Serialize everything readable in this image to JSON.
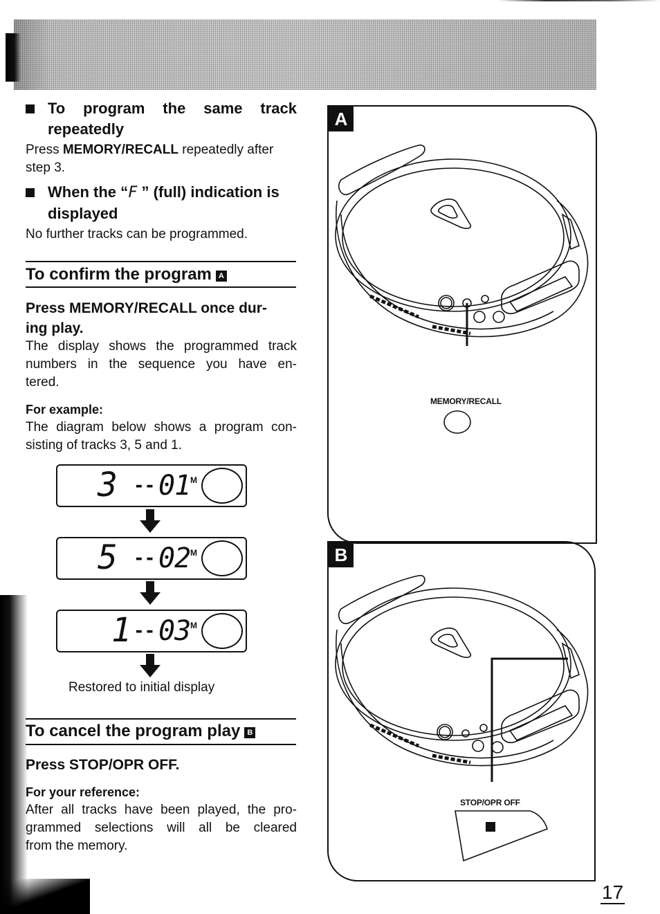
{
  "page": {
    "number": "17"
  },
  "left_column": {
    "repeat_section": {
      "heading": "To program the same track repeatedly",
      "heading_line1": "To program the same track",
      "heading_line2": "repeatedly",
      "body_prefix": "Press ",
      "body_bold": "MEMORY/RECALL",
      "body_suffix": " repeatedly after",
      "body_line2": "step 3."
    },
    "full_section": {
      "heading_line1_prefix": "When the “",
      "full_symbol": "F",
      "heading_line1_suffix": " ” (full) indication is",
      "heading_line2": "displayed",
      "body": "No further tracks can be programmed."
    },
    "confirm_section": {
      "title": "To confirm the program",
      "badge": "A",
      "instruction_line1": "Press MEMORY/RECALL once dur-",
      "instruction_line2": "ing play.",
      "body_line1": "The display shows the programmed track",
      "body_line2": "numbers in the sequence you have en-",
      "body_line3": "tered.",
      "example_label": "For example:",
      "example_line1": "The diagram below shows a program con-",
      "example_line2": "sisting of tracks 3, 5 and 1.",
      "displays": [
        {
          "track": "3",
          "separator": "--",
          "step": "01",
          "indicator": "M"
        },
        {
          "track": "5",
          "separator": "--",
          "step": "02",
          "indicator": "M"
        },
        {
          "track": "1",
          "separator": "--",
          "step": "03",
          "indicator": "M"
        }
      ],
      "final_caption": "Restored to initial display"
    },
    "cancel_section": {
      "title": "To cancel the program play",
      "badge": "B",
      "instruction": "Press STOP/OPR OFF.",
      "reference_label": "For your reference:",
      "reference_line1": "After all tracks have been played, the pro-",
      "reference_line2": "grammed selections will all be cleared",
      "reference_line3": "from the memory."
    }
  },
  "figures": {
    "panel_a": {
      "badge": "A",
      "callout_label": "MEMORY/RECALL",
      "button_icon": "round-button-icon"
    },
    "panel_b": {
      "badge": "B",
      "callout_label": "STOP/OPR OFF",
      "button_icon": "stop-button-icon"
    }
  }
}
